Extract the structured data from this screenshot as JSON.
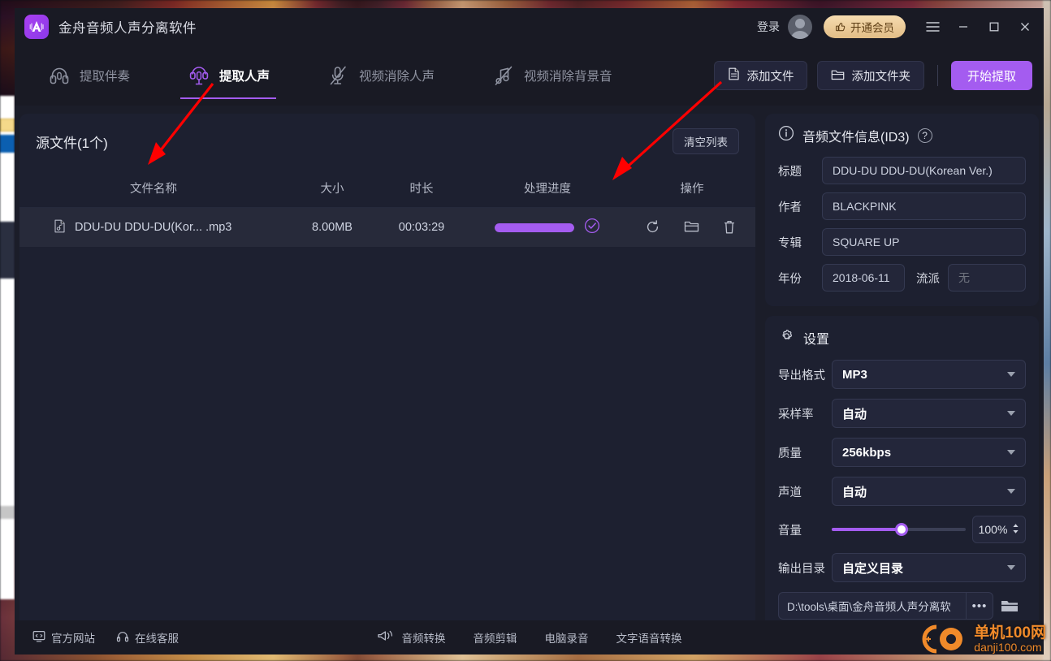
{
  "titlebar": {
    "logo_letter": "A",
    "title": "金舟音频人声分离软件",
    "login_label": "登录",
    "vip_label": "开通会员",
    "vip_icon": "thumbs-up-icon",
    "menu_icon": "hamburger-menu-icon",
    "minimize_icon": "minimize-icon",
    "maximize_icon": "maximize-icon",
    "close_icon": "close-icon",
    "avatar": "avatar"
  },
  "toolbar": {
    "tabs": [
      {
        "label": "提取伴奏",
        "icon": "headphones-icon",
        "active": false
      },
      {
        "label": "提取人声",
        "icon": "microphone-icon",
        "active": true
      },
      {
        "label": "视频消除人声",
        "icon": "microphone-muted-icon",
        "active": false
      },
      {
        "label": "视频消除背景音",
        "icon": "music-note-muted-icon",
        "active": false
      }
    ],
    "add_file_label": "添加文件",
    "add_file_icon": "file-icon",
    "add_folder_label": "添加文件夹",
    "add_folder_icon": "folder-icon",
    "start_label": "开始提取"
  },
  "filepanel": {
    "title": "源文件(1个)",
    "clear_label": "清空列表",
    "columns": {
      "name": "文件名称",
      "size": "大小",
      "duration": "时长",
      "progress": "处理进度",
      "operations": "操作"
    },
    "rows": [
      {
        "name": "DDU-DU DDU-DU(Kor... .mp3",
        "size": "8.00MB",
        "duration": "00:03:29",
        "progress_percent": 100,
        "status": "completed",
        "file_icon": "audio-file-icon",
        "ops": [
          "refresh-icon",
          "folder-icon",
          "trash-icon"
        ]
      }
    ]
  },
  "id3": {
    "title": "音频文件信息(ID3)",
    "info_icon": "info-icon",
    "help_icon": "help-icon",
    "fields": {
      "title_label": "标题",
      "title_value": "DDU-DU DDU-DU(Korean Ver.)",
      "artist_label": "作者",
      "artist_value": "BLACKPINK",
      "album_label": "专辑",
      "album_value": "SQUARE UP",
      "year_label": "年份",
      "year_value": "2018-06-11",
      "genre_label": "流派",
      "genre_placeholder": "无"
    }
  },
  "settings": {
    "title": "设置",
    "gear_icon": "gear-icon",
    "export_format_label": "导出格式",
    "export_format_value": "MP3",
    "sample_rate_label": "采样率",
    "sample_rate_value": "自动",
    "quality_label": "质量",
    "quality_value": "256kbps",
    "channel_label": "声道",
    "channel_value": "自动",
    "volume_label": "音量",
    "volume_value": "100%",
    "volume_percent": 52,
    "output_dir_label": "输出目录",
    "output_dir_value": "自定义目录",
    "output_path": "D:\\tools\\桌面\\金舟音频人声分离软",
    "dots_label": "•••",
    "folder_icon": "folder-open-icon"
  },
  "statusbar": {
    "website_label": "官方网站",
    "website_icon": "monitor-icon",
    "support_label": "在线客服",
    "support_icon": "headset-icon",
    "megaphone_icon": "megaphone-icon",
    "links": [
      "音频转换",
      "音频剪辑",
      "电脑录音",
      "文字语音转换"
    ]
  },
  "watermark": {
    "title": "单机100网",
    "subtitle": "danji100.com"
  },
  "colors": {
    "accent": "#a45cf0",
    "panel": "#1d2030",
    "window": "#1b1d29",
    "bar": "#191a24",
    "vip": "#e2bd86",
    "annotation": "#ff0000"
  }
}
